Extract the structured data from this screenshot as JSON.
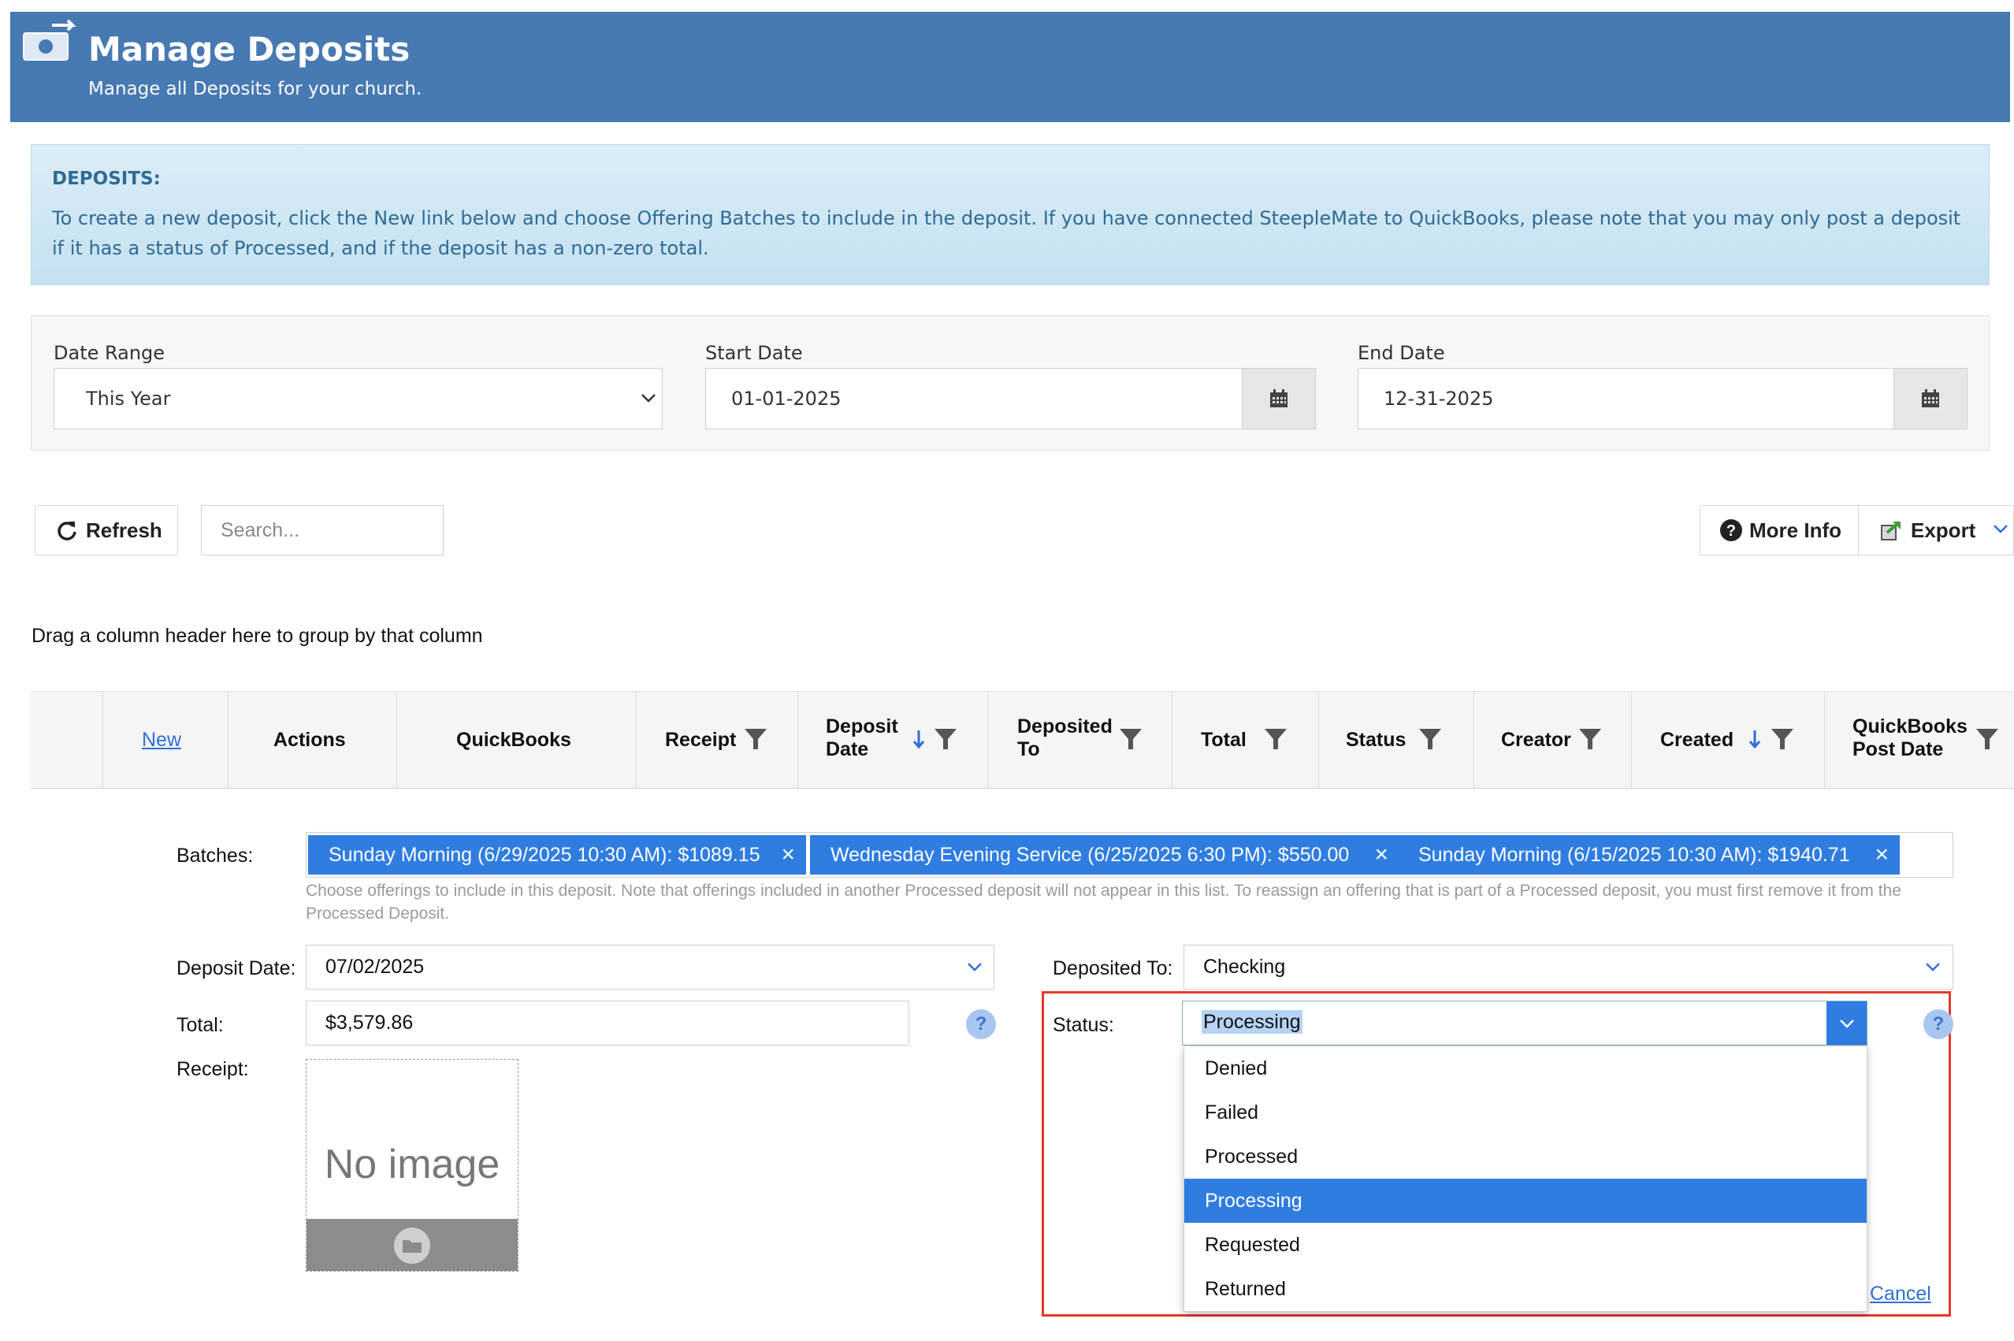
{
  "header": {
    "title": "Manage Deposits",
    "subtitle": "Manage all Deposits for your church.",
    "icon": "money-transfer-icon",
    "bg_color": "#4779b3"
  },
  "info": {
    "title": "DEPOSITS:",
    "text": "To create a new deposit, click the New link below and choose Offering Batches to include in the deposit. If you have connected SteepleMate to QuickBooks, please note that you may only post a deposit if it has a status of Processed, and if the deposit has a non-zero total."
  },
  "filters": {
    "date_range_label": "Date Range",
    "date_range_value": "This Year",
    "start_date_label": "Start Date",
    "start_date_value": "01-01-2025",
    "end_date_label": "End Date",
    "end_date_value": "12-31-2025"
  },
  "toolbar": {
    "refresh_label": "Refresh",
    "search_placeholder": "Search...",
    "more_info_label": "More Info",
    "export_label": "Export"
  },
  "grid": {
    "group_hint": "Drag a column header here to group by that column",
    "new_link": "New",
    "columns": {
      "actions": "Actions",
      "quickbooks": "QuickBooks",
      "receipt": "Receipt",
      "deposit_date_1": "Deposit",
      "deposit_date_2": "Date",
      "deposited_to_1": "Deposited",
      "deposited_to_2": "To",
      "total": "Total",
      "status": "Status",
      "creator": "Creator",
      "created": "Created",
      "qb_post_date_1": "QuickBooks",
      "qb_post_date_2": "Post Date"
    }
  },
  "form": {
    "batches_label": "Batches:",
    "batches": [
      "Sunday Morning (6/29/2025 10:30 AM): $1089.15",
      "Wednesday Evening Service (6/25/2025 6:30 PM): $550.00",
      "Sunday Morning (6/15/2025 10:30 AM): $1940.71"
    ],
    "batches_hint": "Choose offerings to include in this deposit. Note that offerings included in another Processed deposit will not appear in this list. To reassign an offering that is part of a Processed deposit, you must first remove it from the Processed Deposit.",
    "deposit_date_label": "Deposit Date:",
    "deposit_date_value": "07/02/2025",
    "deposited_to_label": "Deposited To:",
    "deposited_to_value": "Checking",
    "total_label": "Total:",
    "total_value": "$3,579.86",
    "receipt_label": "Receipt:",
    "receipt_placeholder": "No image",
    "status_label": "Status:",
    "status_value": "Processing",
    "status_options": [
      "Denied",
      "Failed",
      "Processed",
      "Processing",
      "Requested",
      "Returned"
    ],
    "cancel_label": "Cancel",
    "help_glyph": "?"
  },
  "colors": {
    "accent": "#2f7de1",
    "highlight_border": "#e8372b"
  }
}
